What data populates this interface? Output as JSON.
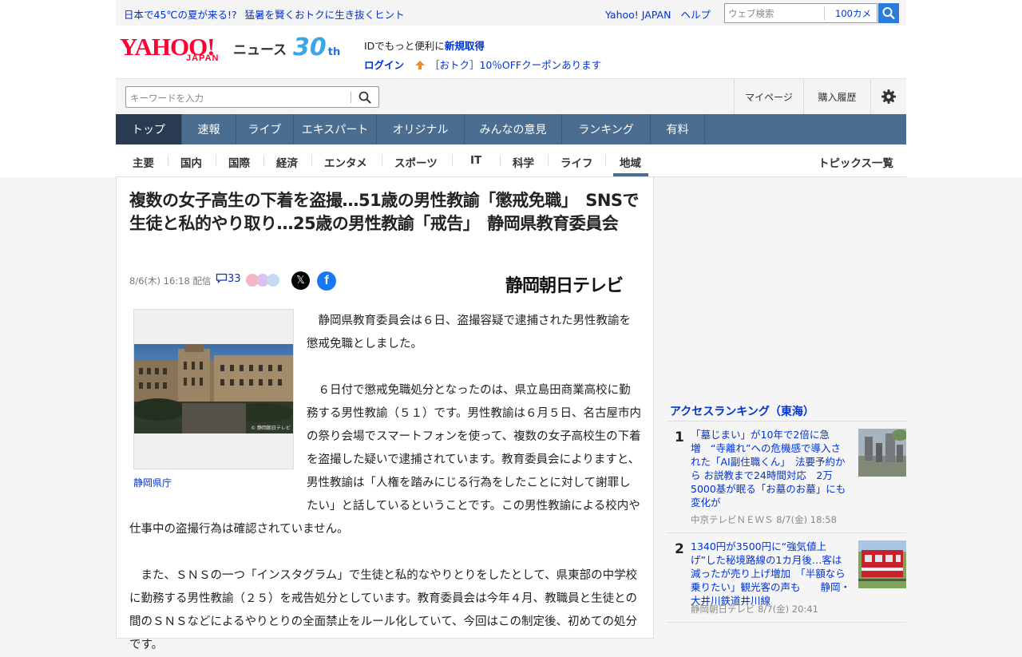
{
  "topbar": {
    "promo_1": "日本で45℃の夏が来る!?",
    "promo_2": "猛暑を賢くおトクに生き抜くヒント",
    "yahoo_japan": "Yahoo! JAPAN",
    "help": "ヘルプ",
    "search_placeholder": "ウェブ検索",
    "camera_label": "100カメ"
  },
  "header": {
    "logo_yahoo": "YAHOO!",
    "logo_japan": "JAPAN",
    "logo_news": "ニュース",
    "logo_30": "30",
    "logo_30_suffix": "th",
    "account_line1_prefix": "IDでもっと便利に",
    "account_line1_link": "新規取得",
    "login": "ログイン",
    "coupon": "［おトク］10％OFFクーポンあります"
  },
  "searchbar": {
    "placeholder": "キーワードを入力",
    "mypage": "マイページ",
    "history": "購入履歴"
  },
  "main_nav": [
    {
      "label": "トップ",
      "active": true
    },
    {
      "label": "速報"
    },
    {
      "label": "ライブ"
    },
    {
      "label": "エキスパート"
    },
    {
      "label": "オリジナル"
    },
    {
      "label": "みんなの意見"
    },
    {
      "label": "ランキング"
    },
    {
      "label": "有料"
    }
  ],
  "sub_nav": {
    "categories": [
      "主要",
      "国内",
      "国際",
      "経済",
      "エンタメ",
      "スポーツ",
      "IT",
      "科学",
      "ライフ",
      "地域"
    ],
    "active": "地域",
    "topics": "トピックス一覧"
  },
  "article": {
    "headline": "複数の女子高生の下着を盗撮…51歳の男性教諭「懲戒免職」　SNSで生徒と私的やり取り…25歳の男性教諭「戒告」　静岡県教育委員会",
    "date": "8/6(木) 16:18",
    "delivered": "配信",
    "comment_count": "33",
    "source": "静岡朝日テレビ",
    "photo_caption": "静岡県庁",
    "photo_credit": "© 静岡朝日テレビ",
    "paragraphs": [
      "静岡県教育委員会は６日、盗撮容疑で逮捕された男性教諭を懲戒免職としました。",
      "６日付で懲戒免職処分となったのは、県立島田商業高校に勤務する男性教諭（５１）です。男性教諭は６月５日、名古屋市内の祭り会場でスマートフォンを使って、複数の女子高校生の下着を盗撮した疑いで逮捕されています。教育委員会によりますと、男性教諭は「人権を踏みにじる行為をしたことに対して謝罪したい」と話しているということです。この男性教諭による校内や仕事中の盗撮行為は確認されていません。",
      "また、ＳＮＳの一つ「インスタグラム」で生徒と私的なやりとりをしたとして、県東部の中学校に勤務する男性教諭（２５）を戒告処分としています。教育委員会は今年４月、教職員と生徒との間のＳＮＳなどによるやりとりの全面禁止をルール化していて、今回はこの制定後、初めての処分です。"
    ]
  },
  "sidebar": {
    "ranking_title": "アクセスランキング（東海）",
    "items": [
      {
        "rank": "1",
        "title": "「墓じまい」が10年で2倍に急増　“寺離れ”への危機感で導入された「AI副住職くん」　法要予約から お説教まで24時間対応　2万5000基が眠る「お墓のお墓」にも変化が",
        "source": "中京テレビＮＥＷＳ",
        "time": "8/7(金) 18:58"
      },
      {
        "rank": "2",
        "title": "1340円が3500円に“強気値上げ”した秘境路線の1カ月後…客は減ったが売り上げ増加　「半額なら乗りたい」観光客の声も　　静岡・大井川鉄道井川線",
        "source": "静岡朝日テレビ",
        "time": "8/7(金) 20:41"
      }
    ]
  },
  "colors": {
    "nav_bg": "#4a6d90",
    "nav_active": "#2a3a50",
    "link": "#0033cc",
    "logo_red": "#ff0033",
    "search_button": "#2a7bdc"
  }
}
